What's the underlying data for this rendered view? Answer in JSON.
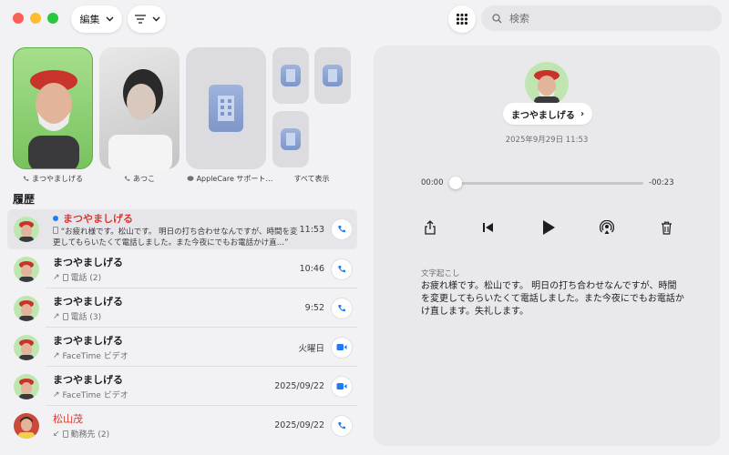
{
  "toolbar": {
    "edit_label": "編集",
    "search_placeholder": "検索"
  },
  "favorites": [
    {
      "name": "まつやましげる",
      "kind": "phone"
    },
    {
      "name": "あつこ",
      "kind": "phone"
    },
    {
      "name": "AppleCare サポート…",
      "kind": "message"
    },
    {
      "name": "すべて表示",
      "kind": "none"
    }
  ],
  "history": {
    "title": "履歴",
    "rows": [
      {
        "name": "まつやましげる",
        "preview": "“お疲れ様です。松山です。 明日の打ち合わせなんですが、時間を変更してもらいたくて電話しました。また今夜にでもお電話かけ直…”",
        "time": "11:53",
        "unread": true,
        "missed": true,
        "action": "phone"
      },
      {
        "name": "まつやましげる",
        "sub": "電話 (2)",
        "time": "10:46",
        "action": "phone"
      },
      {
        "name": "まつやましげる",
        "sub": "電話 (3)",
        "time": "9:52",
        "action": "phone"
      },
      {
        "name": "まつやましげる",
        "sub": "FaceTime ビデオ",
        "time": "火曜日",
        "action": "video"
      },
      {
        "name": "まつやましげる",
        "sub": "FaceTime ビデオ",
        "time": "2025/09/22",
        "action": "video"
      },
      {
        "name": "松山茂",
        "sub": "勤務先 (2)",
        "time": "2025/09/22",
        "action": "phone",
        "missed": true
      }
    ]
  },
  "detail": {
    "name": "まつやましげる",
    "date": "2025年9月29日 11:53",
    "elapsed": "00:00",
    "remaining": "-00:23",
    "progress": 0,
    "transcript_label": "文字起こし",
    "transcript": "お疲れ様です。松山です。 明日の打ち合わせなんですが、時間を変更してもらいたくて電話しました。また今夜にでもお電話かけ直します。失礼します。"
  },
  "colors": {
    "accent": "#1f7cf5",
    "missed": "#e0362c",
    "avatar_bg": "#bfe6b0"
  }
}
